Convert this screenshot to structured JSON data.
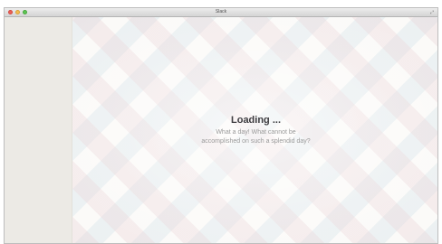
{
  "window": {
    "title": "Slack",
    "fullscreen_icon": "⤢"
  },
  "loading": {
    "title": "Loading ...",
    "message_line1": "What a day! What cannot be",
    "message_line2": "accomplished on such a splendid day?"
  },
  "colors": {
    "sidebar": "#eceae5",
    "title_text": "#3d3c40",
    "message_text": "#9a9a9a",
    "close": "#ec5f56",
    "minimize": "#f5be4f",
    "maximize": "#5fc654"
  },
  "icons": {
    "close": "close-button",
    "minimize": "minimize-button",
    "maximize": "maximize-button",
    "fullscreen": "fullscreen-icon"
  }
}
